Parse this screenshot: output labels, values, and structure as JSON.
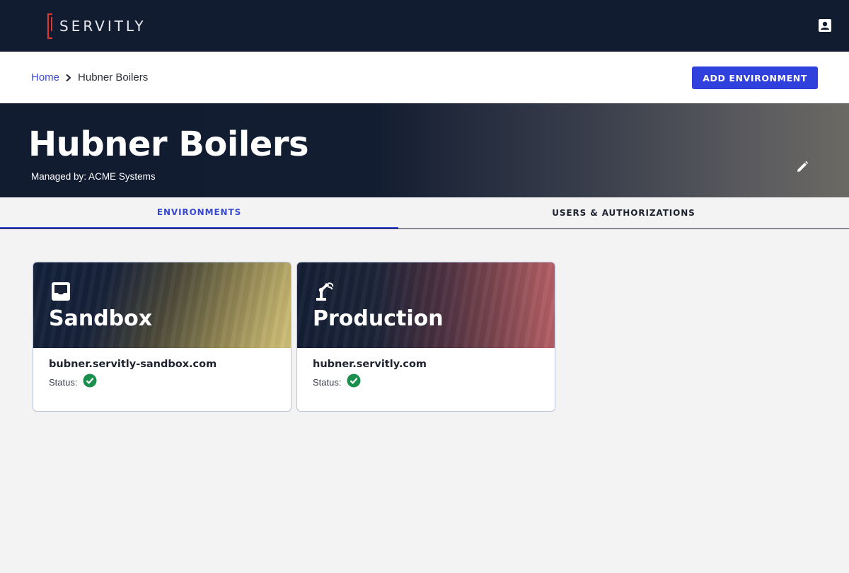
{
  "app": {
    "brand": "SERVITLY",
    "colors": {
      "navy": "#121c30",
      "accent": "#3040dc",
      "brand_red": "#d6392e",
      "status_ok": "#1a8f4e"
    }
  },
  "breadcrumb": {
    "home": "Home",
    "current": "Hubner Boilers"
  },
  "toolbar": {
    "add_environment_label": "ADD ENVIRONMENT"
  },
  "hero": {
    "title": "Hubner Boilers",
    "subtitle": "Managed by: ACME Systems"
  },
  "tabs": [
    {
      "label": "ENVIRONMENTS",
      "active": true
    },
    {
      "label": "USERS & AUTHORIZATIONS",
      "active": false
    }
  ],
  "environments": [
    {
      "name": "Sandbox",
      "url": "bubner.servitly-sandbox.com",
      "status_label": "Status:",
      "status": "ok",
      "icon": "inbox-icon"
    },
    {
      "name": "Production",
      "url": "hubner.servitly.com",
      "status_label": "Status:",
      "status": "ok",
      "icon": "robot-arm-icon"
    }
  ]
}
